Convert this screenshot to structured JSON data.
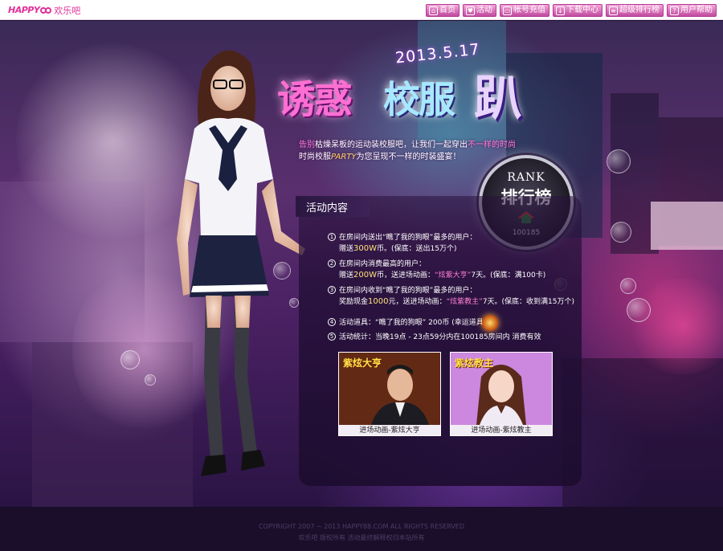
{
  "brand": {
    "logo_text": "HAPPY",
    "name": "欢乐吧"
  },
  "nav": [
    {
      "label": "首页",
      "icon": "home-icon"
    },
    {
      "label": "活动",
      "icon": "gift-icon"
    },
    {
      "label": "帐号充值",
      "icon": "card-icon"
    },
    {
      "label": "下载中心",
      "icon": "download-icon"
    },
    {
      "label": "超级排行榜",
      "icon": "list-icon"
    },
    {
      "label": "用户帮助",
      "icon": "help-icon"
    }
  ],
  "hero": {
    "date": "2013.5.17",
    "title_a": "诱惑",
    "title_b": "校服",
    "title_c": "趴",
    "intro_line1_hl": "告别",
    "intro_line1": "枯燥呆板的运动装校服吧，让我们一起穿出",
    "intro_line1_hl2": "不一样的时尚",
    "intro_line2_a": "时尚校服",
    "intro_line2_party": "PARTY",
    "intro_line2_b": "为您呈现不一样的时装盛宴！"
  },
  "rank": {
    "en": "RANK",
    "cn": "排行榜",
    "room": "100185"
  },
  "activity": {
    "tab_title": "活动内容",
    "rules": [
      {
        "n": "1",
        "l1": "在房间内送出“瞧了我的狗眼”最多的用户：",
        "l2a": "赠送",
        "l2big": "300W",
        "l2b": "币。(保底：送出15万个)"
      },
      {
        "n": "2",
        "l1": "在房间内消费最高的用户：",
        "l2a": "赠送",
        "l2big": "200W",
        "l2b": "币，送进场动画：",
        "l2pink": "“炫紫大亨”",
        "l2c": "7天。(保底：满100卡)"
      },
      {
        "n": "3",
        "l1": "在房间内收到“瞧了我的狗眼”最多的用户：",
        "l2a": "奖励现金",
        "l2big": "1000",
        "l2b": "元，送进场动画：",
        "l2pink": "“炫紫教主”",
        "l2c": "7天。(保底：收到满15万个)"
      },
      {
        "n": "4",
        "l1": "活动道具：“瞧了我的狗眼” 200币 (幸运道具)"
      },
      {
        "n": "5",
        "l1": "活动统计：当晚19点 - 23点59分内在100185房间内 消费有效"
      }
    ],
    "cards": [
      {
        "tag": "紫炫大亨",
        "caption": "进场动画-紫炫大亨"
      },
      {
        "tag": "紫炫教主",
        "caption": "进场动画-紫炫教主"
      }
    ]
  },
  "footer": {
    "copyright": "COPYRIGHT 2007 ~ 2013 HAPPY88.COM ALL RIGHTS RESERVED",
    "sub": "欢乐吧 版权所有 活动最终解释权归本站所有"
  },
  "colors": {
    "accent": "#e0309a",
    "nav_bg": "#c14aa0",
    "highlight": "#ff7fd4",
    "gold": "#ffe27a"
  }
}
